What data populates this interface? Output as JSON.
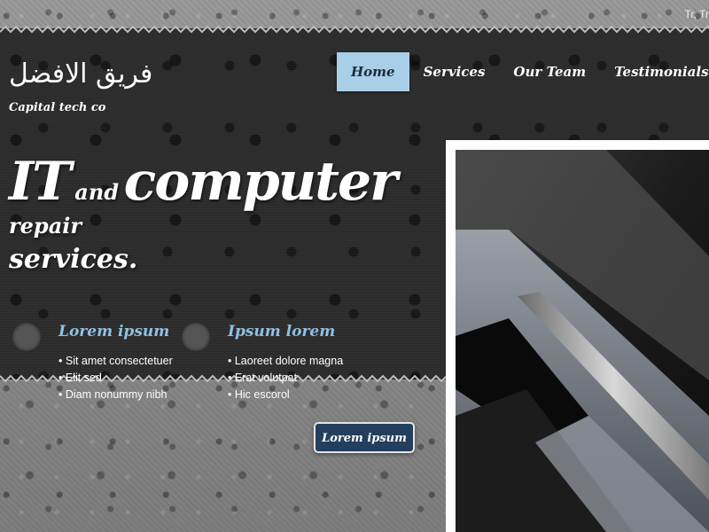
{
  "topbar": {
    "language_link": "Tr, Tr"
  },
  "brand": {
    "title": "فريق الافضل",
    "subtitle": "Capital tech co"
  },
  "nav": {
    "items": [
      {
        "label": "Home",
        "active": true
      },
      {
        "label": "Services",
        "active": false
      },
      {
        "label": "Our Team",
        "active": false
      },
      {
        "label": "Testimonials",
        "active": false
      }
    ]
  },
  "hero": {
    "word1": "IT",
    "word2": "and",
    "word3": "computer",
    "word4": "repair",
    "word5": "services."
  },
  "features": [
    {
      "title": "Lorem ipsum",
      "items": [
        "Sit amet consectetuer",
        "Elit sed",
        "Diam nonummy nibh"
      ]
    },
    {
      "title": "Ipsum lorem",
      "items": [
        "Laoreet dolore magna",
        "Erat volutpat",
        "Hic escorol"
      ]
    }
  ],
  "cta": {
    "label": "Lorem ipsum"
  },
  "colors": {
    "nav_active": "#a9cfe8",
    "feature_title": "#8fc1e3",
    "cta_bg": "#243e5e",
    "dark_band": "#2c2c2c"
  },
  "icons": {
    "feature_bullet": "circle-icon"
  }
}
